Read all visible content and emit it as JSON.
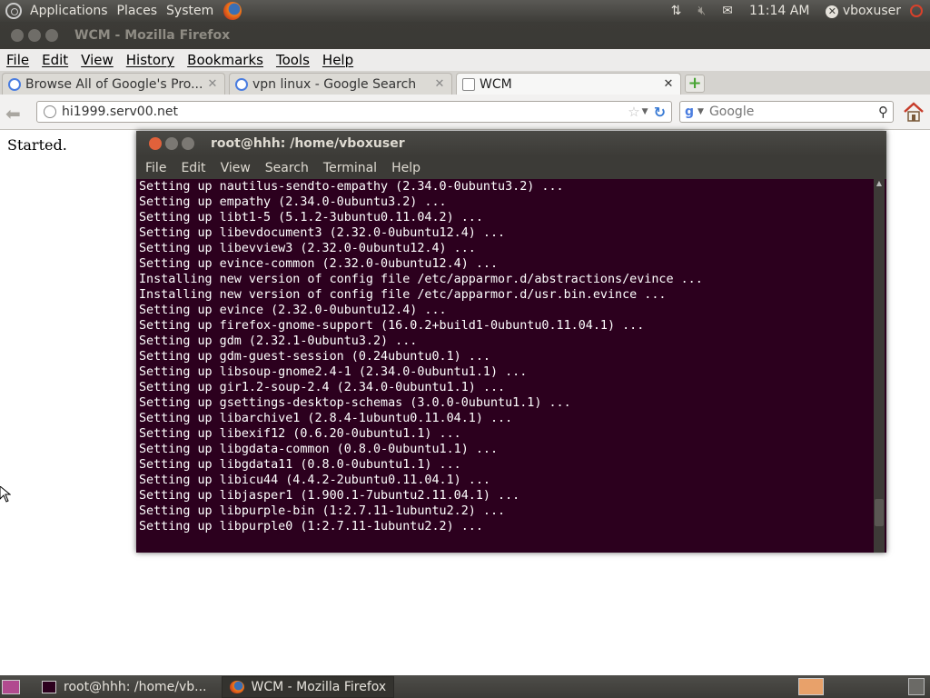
{
  "top_panel": {
    "menus": [
      "Applications",
      "Places",
      "System"
    ],
    "clock": "11:14 AM",
    "user": "vboxuser"
  },
  "firefox": {
    "title": "WCM - Mozilla Firefox",
    "menu": [
      "File",
      "Edit",
      "View",
      "History",
      "Bookmarks",
      "Tools",
      "Help"
    ],
    "tabs": [
      {
        "label": "Browse All of Google's Pro..."
      },
      {
        "label": "vpn linux - Google Search"
      },
      {
        "label": "WCM"
      }
    ],
    "url": "hi1999.serv00.net",
    "search_placeholder": "Google"
  },
  "page": {
    "text": "Started."
  },
  "terminal": {
    "title": "root@hhh: /home/vboxuser",
    "menu": [
      "File",
      "Edit",
      "View",
      "Search",
      "Terminal",
      "Help"
    ],
    "lines": [
      "Setting up nautilus-sendto-empathy (2.34.0-0ubuntu3.2) ...",
      "Setting up empathy (2.34.0-0ubuntu3.2) ...",
      "Setting up libt1-5 (5.1.2-3ubuntu0.11.04.2) ...",
      "Setting up libevdocument3 (2.32.0-0ubuntu12.4) ...",
      "Setting up libevview3 (2.32.0-0ubuntu12.4) ...",
      "Setting up evince-common (2.32.0-0ubuntu12.4) ...",
      "Installing new version of config file /etc/apparmor.d/abstractions/evince ...",
      "Installing new version of config file /etc/apparmor.d/usr.bin.evince ...",
      "Setting up evince (2.32.0-0ubuntu12.4) ...",
      "Setting up firefox-gnome-support (16.0.2+build1-0ubuntu0.11.04.1) ...",
      "Setting up gdm (2.32.1-0ubuntu3.2) ...",
      "Setting up gdm-guest-session (0.24ubuntu0.1) ...",
      "Setting up libsoup-gnome2.4-1 (2.34.0-0ubuntu1.1) ...",
      "Setting up gir1.2-soup-2.4 (2.34.0-0ubuntu1.1) ...",
      "Setting up gsettings-desktop-schemas (3.0.0-0ubuntu1.1) ...",
      "Setting up libarchive1 (2.8.4-1ubuntu0.11.04.1) ...",
      "Setting up libexif12 (0.6.20-0ubuntu1.1) ...",
      "Setting up libgdata-common (0.8.0-0ubuntu1.1) ...",
      "Setting up libgdata11 (0.8.0-0ubuntu1.1) ...",
      "Setting up libicu44 (4.4.2-2ubuntu0.11.04.1) ...",
      "Setting up libjasper1 (1.900.1-7ubuntu2.11.04.1) ...",
      "Setting up libpurple-bin (1:2.7.11-1ubuntu2.2) ...",
      "Setting up libpurple0 (1:2.7.11-1ubuntu2.2) ..."
    ]
  },
  "taskbar": {
    "tasks": [
      {
        "label": "root@hhh: /home/vb..."
      },
      {
        "label": "WCM - Mozilla Firefox"
      }
    ]
  }
}
